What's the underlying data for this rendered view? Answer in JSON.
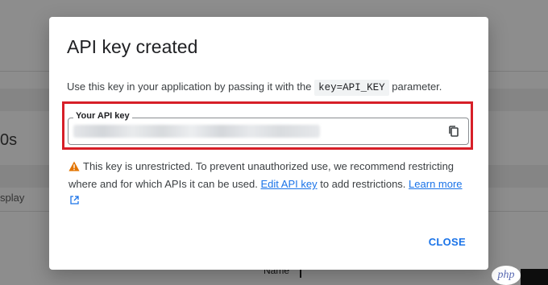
{
  "background": {
    "heading_fragment": "0s",
    "cell_fragment": "splay",
    "column_name": "Name",
    "watermark": "php"
  },
  "dialog": {
    "title": "API key created",
    "description_before": "Use this key in your application by passing it with the",
    "description_code": "key=API_KEY",
    "description_after": "parameter.",
    "key_field_label": "Your API key",
    "key_value": "",
    "copy_icon": "copy-icon",
    "warning_icon": "warning-icon",
    "warning_text": "This key is unrestricted. To prevent unauthorized use, we recommend restricting where and for which APIs it can be used.",
    "edit_link": "Edit API key",
    "after_edit_text": "to add restrictions.",
    "learn_more": "Learn more",
    "close_label": "CLOSE"
  },
  "colors": {
    "accent": "#1a73e8",
    "highlight_border": "#d71f28",
    "warning": "#e37400"
  }
}
